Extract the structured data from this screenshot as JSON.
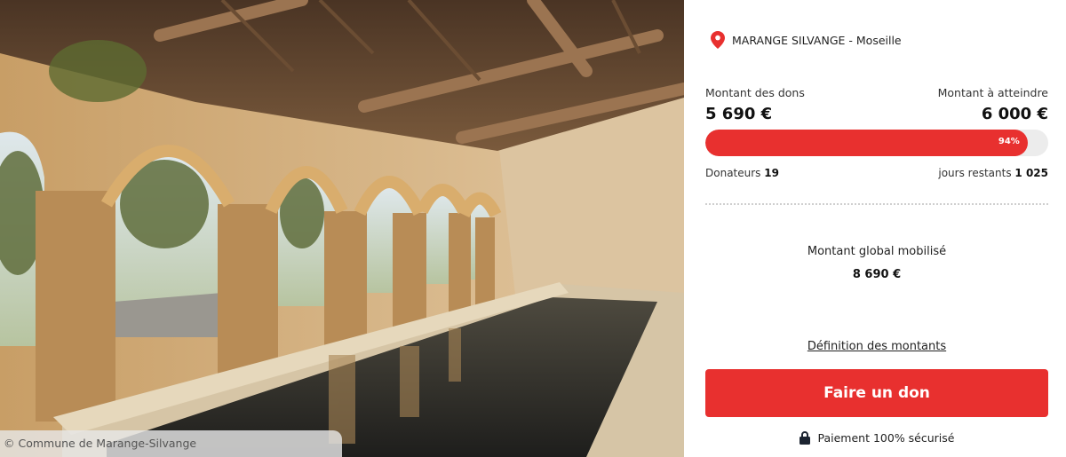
{
  "photo": {
    "credit": "© Commune de Marange-Silvange"
  },
  "location": {
    "icon": "map-pin-icon",
    "text": "MARANGE SILVANGE - Moseille"
  },
  "funding": {
    "raised_label": "Montant des dons",
    "raised_value": "5 690 €",
    "goal_label": "Montant à atteindre",
    "goal_value": "6 000 €",
    "progress_percent": 94,
    "progress_label": "94%",
    "donors_label": "Donateurs",
    "donors_value": "19",
    "days_label": "jours restants",
    "days_value": "1 025"
  },
  "global": {
    "label": "Montant global mobilisé",
    "value": "8 690 €"
  },
  "definition_link": "Définition des montants",
  "donate_button": "Faire un don",
  "secure": {
    "icon": "lock-icon",
    "text": "Paiement 100% sécurisé"
  },
  "colors": {
    "accent": "#e8302f",
    "track": "#ececec"
  }
}
